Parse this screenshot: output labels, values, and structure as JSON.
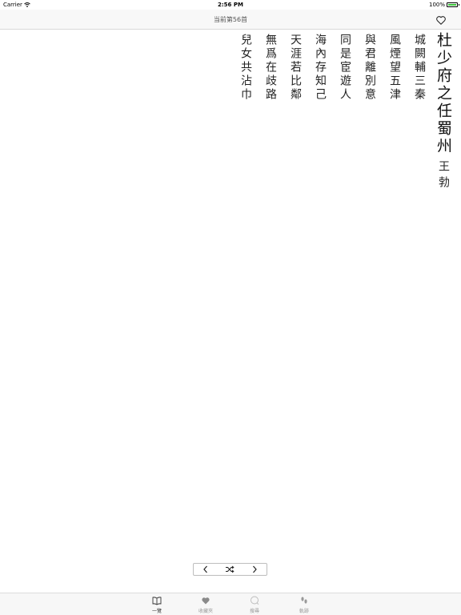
{
  "status_bar": {
    "carrier": "Carrier",
    "time": "2:56 PM",
    "battery": "100%",
    "battery_level": 1.0
  },
  "nav": {
    "title": "当前第56首",
    "favorite_icon": "heart-outline-icon"
  },
  "poem": {
    "title": "杜少府之任蜀州",
    "author": "王勃",
    "lines": [
      "城闕輔三秦",
      "風煙望五津",
      "與君離別意",
      "同是宦遊人",
      "海內存知己",
      "天涯若比鄰",
      "無爲在歧路",
      "兒女共沾巾"
    ]
  },
  "pager": {
    "prev_icon": "chevron-left-icon",
    "shuffle_icon": "shuffle-icon",
    "next_icon": "chevron-right-icon"
  },
  "tabs": [
    {
      "label": "一覽",
      "icon": "book-icon",
      "active": true
    },
    {
      "label": "收藏夾",
      "icon": "heart-icon",
      "active": false
    },
    {
      "label": "搜尋",
      "icon": "search-icon",
      "active": false
    },
    {
      "label": "軌跡",
      "icon": "footprints-icon",
      "active": false
    }
  ],
  "colors": {
    "active_tab": "#333333",
    "inactive_tab": "#999999",
    "battery": "#3dc53d"
  }
}
